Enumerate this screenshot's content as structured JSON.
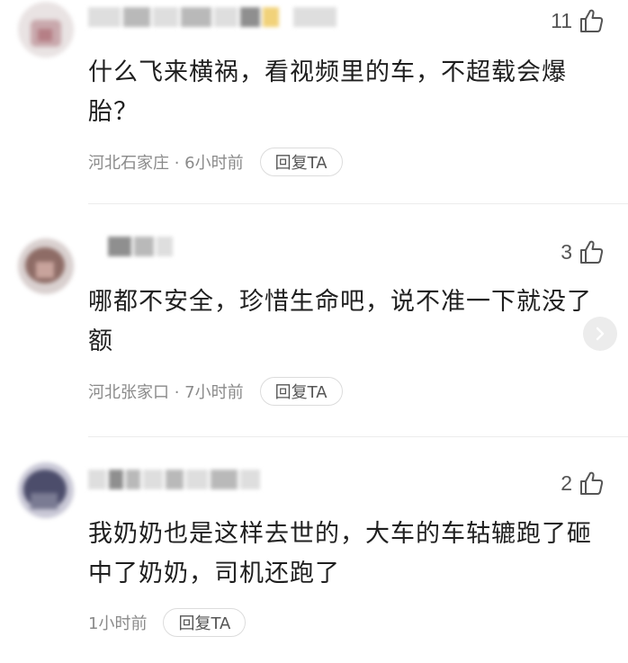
{
  "comments": [
    {
      "likes": "11",
      "text": "什么飞来横祸，看视频里的车，不超载会爆胎？",
      "meta": "河北石家庄 · 6小时前",
      "reply_label": "回复TA"
    },
    {
      "likes": "3",
      "text": "哪都不安全，珍惜生命吧，说不准一下就没了额",
      "meta": "河北张家口 · 7小时前",
      "reply_label": "回复TA"
    },
    {
      "likes": "2",
      "text": "我奶奶也是这样去世的，大车的车轱辘跑了砸中了奶奶，司机还跑了",
      "meta": "1小时前",
      "reply_label": "回复TA"
    }
  ],
  "icons": {
    "like": "thumbs-up-icon",
    "scroll": "chevron-right-icon"
  },
  "colors": {
    "text": "#1f1f1f",
    "meta": "#8a8a8a",
    "divider": "#ececec"
  }
}
